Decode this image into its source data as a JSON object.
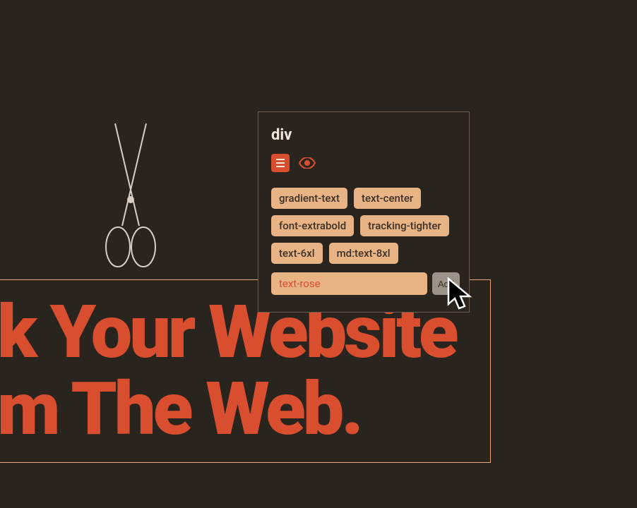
{
  "hero": {
    "line1": "k Your Website",
    "line2": "m The Web."
  },
  "inspector": {
    "element_tag": "div",
    "classes": [
      "gradient-text",
      "text-center",
      "font-extrabold",
      "tracking-tighter",
      "text-6xl",
      "md:text-8xl"
    ],
    "input_value": "text-rose",
    "add_label": "Add"
  },
  "icons": {
    "lines": "lines-icon",
    "eye": "eye-icon",
    "scissors": "scissors-icon"
  }
}
